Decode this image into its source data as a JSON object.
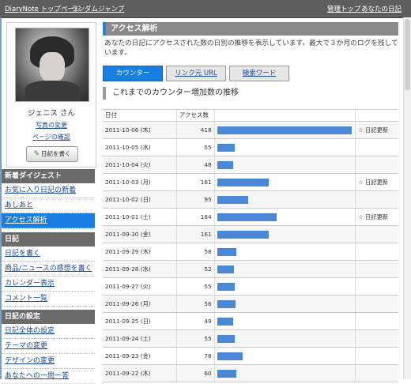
{
  "topbar": {
    "home": "DiaryNote トップページ",
    "random": "ランダムジャンプ",
    "admin_top": "管理トップ",
    "your_diary": "あなたの日記"
  },
  "profile": {
    "username": "ジェニス さん",
    "change_photo": "写真の変更",
    "page_confirm": "ページの確認",
    "write_button": "日記を書く"
  },
  "nav": {
    "news": {
      "header": "新着ダイジェスト",
      "items": [
        "お気に入り日記の新着",
        "あしあと",
        "アクセス解析"
      ]
    },
    "diary": {
      "header": "日記",
      "items": [
        "日記を書く",
        "商品/ニュースの感想を書く",
        "カレンダー表示",
        "コメント一覧"
      ]
    },
    "settings": {
      "header": "日記の設定",
      "items": [
        "日記全体の設定",
        "テーマの変更",
        "デザインの変更",
        "あなたへの一問一答"
      ]
    }
  },
  "main": {
    "title": "アクセス解析",
    "description": "あなたの日記にアクセスされた数の日別の推移を表示しています。最大で３か月のログを残しています。",
    "tabs": [
      "カウンター",
      "リンク元 URL",
      "検索ワード"
    ],
    "section_title": "これまでのカウンター増加数の推移",
    "col_date": "日付",
    "col_count": "アクセス数",
    "note_label": "☆ 日記更新"
  },
  "chart_data": {
    "type": "bar",
    "categories": [
      "2011-10-06 (木)",
      "2011-10-05 (水)",
      "2011-10-04 (火)",
      "2011-10-03 (月)",
      "2011-10-02 (日)",
      "2011-10-01 (土)",
      "2011-09-30 (金)",
      "2011-09-29 (木)",
      "2011-09-28 (水)",
      "2011-09-27 (火)",
      "2011-09-26 (月)",
      "2011-09-25 (日)",
      "2011-09-24 (土)",
      "2011-09-23 (金)",
      "2011-09-22 (木)"
    ],
    "values": [
      418,
      55,
      48,
      161,
      95,
      184,
      161,
      58,
      52,
      55,
      56,
      49,
      55,
      78,
      60
    ],
    "diary_updated": [
      true,
      false,
      false,
      true,
      false,
      true,
      false,
      false,
      false,
      false,
      false,
      false,
      false,
      false,
      false
    ]
  },
  "colors": {
    "bar": "#4a88d6",
    "active_tab": "#1a7ee0",
    "topbar": "#5e5e5e"
  }
}
